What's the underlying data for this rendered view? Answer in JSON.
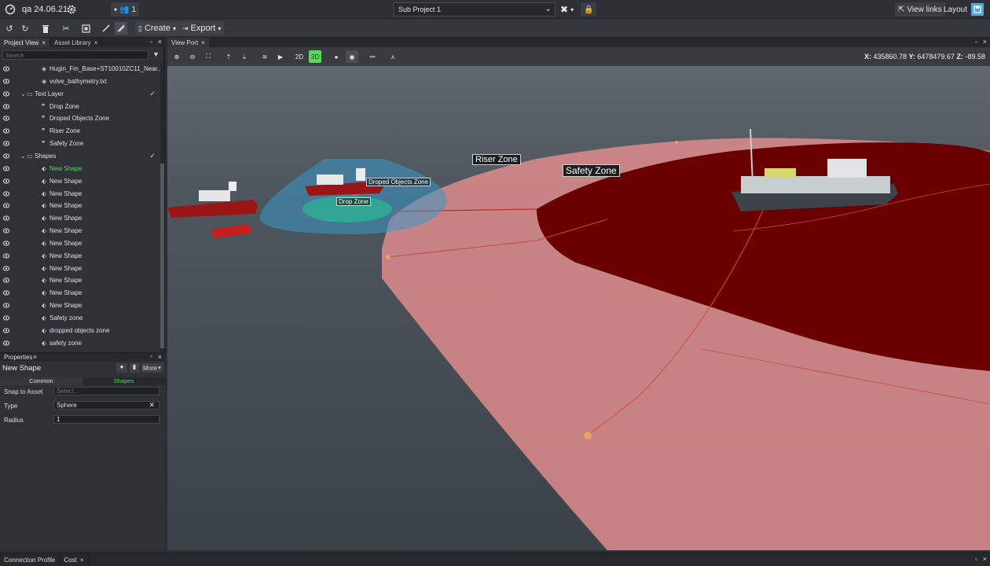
{
  "app": {
    "title": "qa 24.06.21",
    "users_count": "1",
    "sub_project": "Sub Project 1",
    "view_links": "View links",
    "layout": "Layout"
  },
  "toolbar": {
    "create_label": "Create",
    "export_label": "Export"
  },
  "left_tabs": [
    "Project View",
    "Asset Library"
  ],
  "search": {
    "placeholder": "Search"
  },
  "tree": [
    {
      "label": "Hugin_Fm_Base+ST10010ZC11_Near...",
      "indent": 2,
      "icon": "layer-icon"
    },
    {
      "label": "volve_bathymetry.txt",
      "indent": 2,
      "icon": "layer-icon"
    },
    {
      "label": "Text Layer",
      "indent": 1,
      "icon": "folder-icon",
      "expanded": true,
      "checked": true
    },
    {
      "label": "Drop Zone",
      "indent": 2,
      "icon": "quote-icon"
    },
    {
      "label": "Droped Objects Zone",
      "indent": 2,
      "icon": "quote-icon"
    },
    {
      "label": "Riser Zone",
      "indent": 2,
      "icon": "quote-icon"
    },
    {
      "label": "Safety Zone",
      "indent": 2,
      "icon": "quote-icon"
    },
    {
      "label": "Shapes",
      "indent": 1,
      "icon": "folder-icon",
      "expanded": true,
      "checked": true
    },
    {
      "label": "New Shape",
      "indent": 2,
      "icon": "shape-icon",
      "selected": true
    },
    {
      "label": "New Shape",
      "indent": 2,
      "icon": "shape-icon"
    },
    {
      "label": "New Shape",
      "indent": 2,
      "icon": "shape-icon"
    },
    {
      "label": "New Shape",
      "indent": 2,
      "icon": "shape-icon"
    },
    {
      "label": "New Shape",
      "indent": 2,
      "icon": "shape-icon"
    },
    {
      "label": "New Shape",
      "indent": 2,
      "icon": "shape-icon"
    },
    {
      "label": "New Shape",
      "indent": 2,
      "icon": "shape-icon"
    },
    {
      "label": "New Shape",
      "indent": 2,
      "icon": "shape-icon"
    },
    {
      "label": "New Shape",
      "indent": 2,
      "icon": "shape-icon"
    },
    {
      "label": "New Shape",
      "indent": 2,
      "icon": "shape-icon"
    },
    {
      "label": "New Shape",
      "indent": 2,
      "icon": "shape-icon"
    },
    {
      "label": "New Shape",
      "indent": 2,
      "icon": "shape-icon"
    },
    {
      "label": "Safety zone",
      "indent": 2,
      "icon": "shape-icon"
    },
    {
      "label": "dropped objects zone",
      "indent": 2,
      "icon": "shape-icon"
    },
    {
      "label": "safety zone",
      "indent": 2,
      "icon": "shape-icon"
    }
  ],
  "properties": {
    "panel_title": "Properties",
    "object_name": "New Shape",
    "more_label": "More",
    "tabs": [
      "Common",
      "Shapes"
    ],
    "snap_label": "Snap to Asset",
    "snap_placeholder": "Select...",
    "type_label": "Type",
    "type_value": "Sphere",
    "radius_label": "Radius",
    "radius_value": "1"
  },
  "viewport": {
    "tab": "View Port",
    "mode_2d": "2D",
    "mode_3d": "3D",
    "x_label": "X:",
    "x_value": "435860.78",
    "y_label": "Y:",
    "y_value": "6478479.67",
    "z_label": "Z:",
    "z_value": "-89.58",
    "labels": {
      "droped_objects": "Droped Objects Zone",
      "drop": "Drop Zone",
      "riser": "Riser Zone",
      "safety": "Safety Zone"
    }
  },
  "bottom_tabs": [
    "Connection Profile",
    "Cost"
  ],
  "colors": {
    "accent_green": "#5fd35f",
    "safety_zone": "#d98a8a",
    "riser_zone": "#6a0000",
    "sea": "#3f464d"
  }
}
